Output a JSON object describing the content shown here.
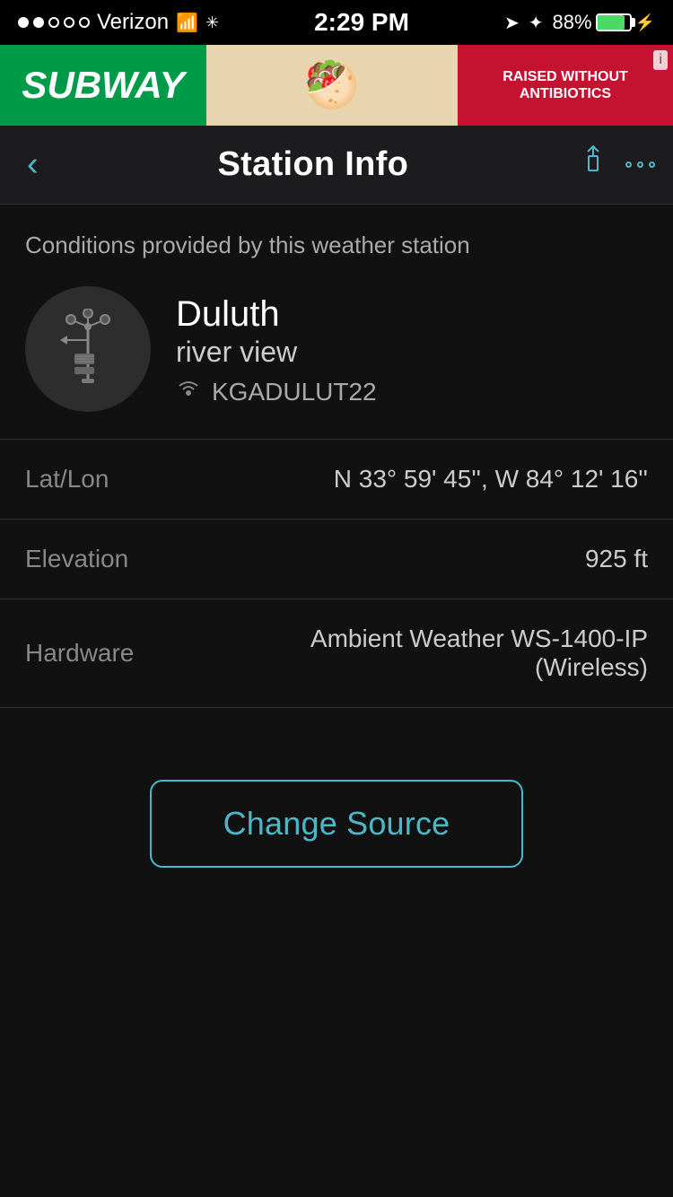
{
  "statusBar": {
    "carrier": "Verizon",
    "time": "2:29 PM",
    "batteryPercent": "88%",
    "signalDots": [
      true,
      true,
      false,
      false,
      false
    ]
  },
  "ad": {
    "subwayText": "SUBWAY",
    "raisedWithout": "RAISED WITHOUT\nANTIBIOTICS",
    "badgeText": "i"
  },
  "navBar": {
    "backLabel": "‹",
    "title": "Station Info"
  },
  "main": {
    "subtitle": "Conditions provided by this weather station",
    "station": {
      "name": "Duluth",
      "subname": "river view",
      "id": "KGADULUT22"
    },
    "rows": [
      {
        "label": "Lat/Lon",
        "value": "N 33° 59' 45'', W 84° 12' 16''"
      },
      {
        "label": "Elevation",
        "value": "925 ft"
      },
      {
        "label": "Hardware",
        "value": "Ambient Weather WS-1400-IP (Wireless)"
      }
    ],
    "changeSourceBtn": "Change Source"
  }
}
